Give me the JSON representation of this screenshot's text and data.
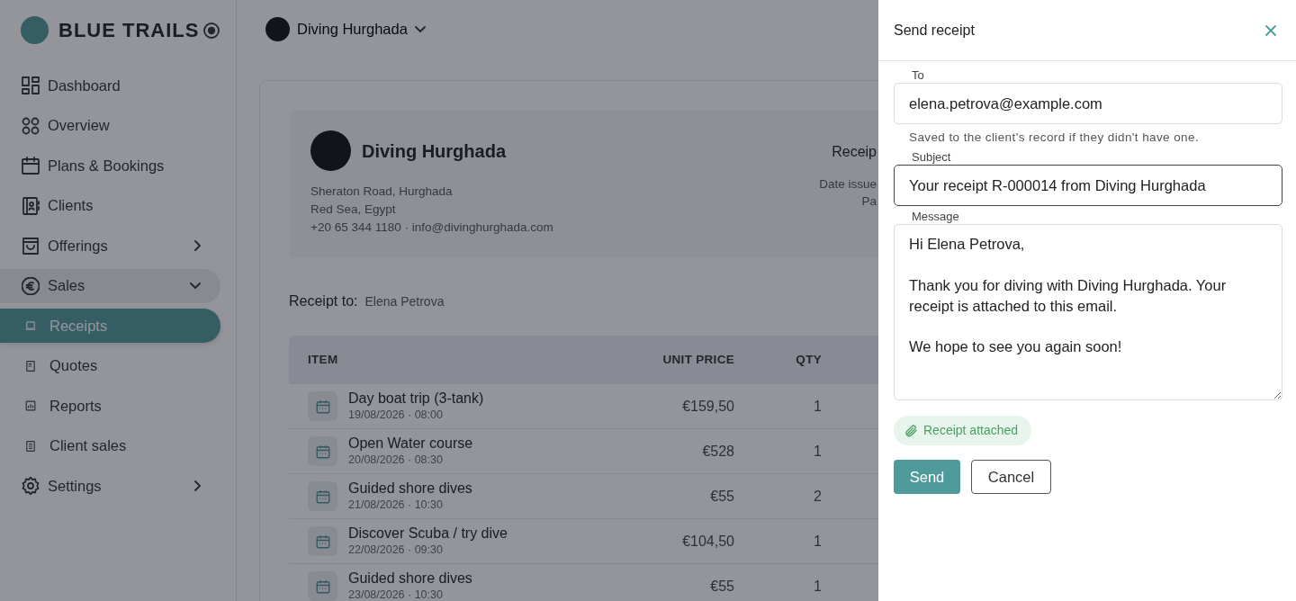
{
  "brand": {
    "name": "BLUE TRAILS"
  },
  "sidebar": {
    "items": [
      {
        "label": "Dashboard"
      },
      {
        "label": "Overview"
      },
      {
        "label": "Plans & Bookings"
      },
      {
        "label": "Clients"
      },
      {
        "label": "Offerings",
        "expanded": false
      },
      {
        "label": "Sales",
        "expanded": true,
        "children": [
          {
            "label": "Receipts",
            "selected": true
          },
          {
            "label": "Quotes",
            "selected": false
          },
          {
            "label": "Reports",
            "selected": false
          },
          {
            "label": "Client sales",
            "selected": false
          }
        ]
      },
      {
        "label": "Settings",
        "expanded": false
      }
    ]
  },
  "org_selector": {
    "label": "Diving Hurghada"
  },
  "receipt": {
    "business_name": "Diving Hurghada",
    "address_lines": [
      "Sheraton Road, Hurghada",
      "Red Sea, Egypt",
      "+20 65 344 1180 · info@divinghurghada.com"
    ],
    "meta_title": "Receip",
    "meta_lines": [
      "Date issue",
      "Pa"
    ],
    "recipient_label": "Receipt to:",
    "recipient": "Elena Petrova"
  },
  "table": {
    "columns": [
      "ITEM",
      "UNIT PRICE",
      "QTY"
    ],
    "rows": [
      {
        "item": "Day boat trip (3-tank)",
        "date": "19/08/2026 · 08:00",
        "unit_price": "€159,50",
        "qty": "1"
      },
      {
        "item": "Open Water course",
        "date": "20/08/2026 · 08:30",
        "unit_price": "€528",
        "qty": "1"
      },
      {
        "item": "Guided shore dives",
        "date": "21/08/2026 · 10:30",
        "unit_price": "€55",
        "qty": "2"
      },
      {
        "item": "Discover Scuba / try dive",
        "date": "22/08/2026 · 09:30",
        "unit_price": "€104,50",
        "qty": "1"
      },
      {
        "item": "Guided shore dives",
        "date": "23/08/2026 · 10:30",
        "unit_price": "€55",
        "qty": "1"
      }
    ]
  },
  "drawer": {
    "title": "Send receipt",
    "fields": [
      {
        "label": "To",
        "value": "elena.petrova@example.com",
        "help": "Saved to the client's record if they didn't have one.",
        "kind": "input",
        "focused": false
      },
      {
        "label": "Subject",
        "value": "Your receipt R-000014 from Diving Hurghada",
        "kind": "input",
        "focused": true
      },
      {
        "label": "Message",
        "value": "Hi Elena Petrova,\n\nThank you for diving with Diving Hurghada. Your receipt is attached to this email.\n\nWe hope to see you again soon!",
        "kind": "textarea",
        "focused": false
      }
    ],
    "attachment": "Receipt attached",
    "buttons": [
      {
        "label": "Send",
        "kind": "primary"
      },
      {
        "label": "Cancel",
        "kind": "secondary"
      }
    ]
  }
}
